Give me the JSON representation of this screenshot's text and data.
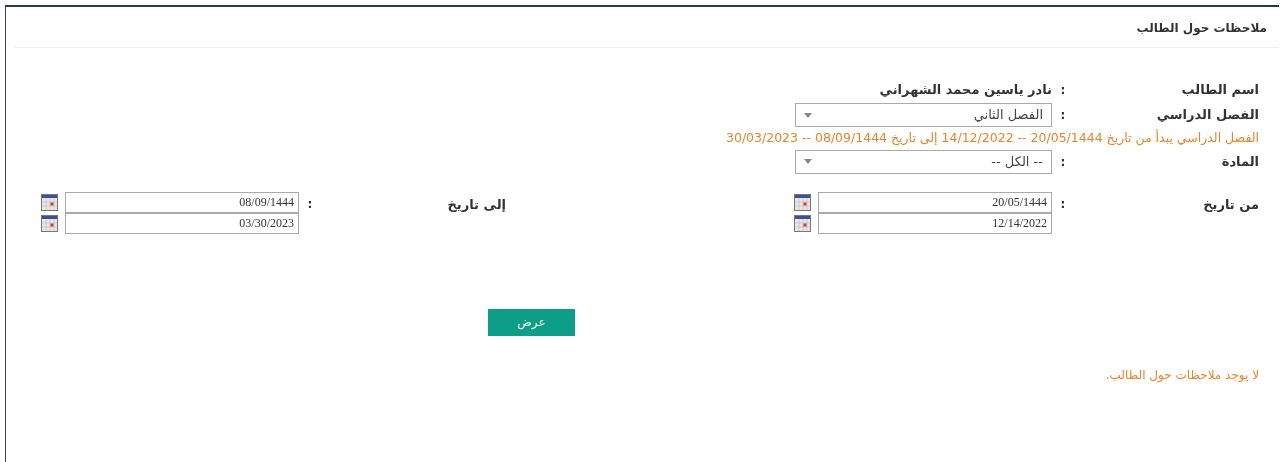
{
  "panel": {
    "title": "ملاحظات حول الطالب"
  },
  "fields": [
    {
      "kind": "text",
      "label": "اسم الطالب",
      "colon": ":",
      "value": "نادر ياسين محمد الشهراني"
    },
    {
      "kind": "select",
      "label": "الفصل الدراسي",
      "colon": ":",
      "value": "الفصل الثاني"
    },
    {
      "kind": "note",
      "text": "الفصل الدراسي يبدأ من تاريخ 20/05/1444 -- 14/12/2022 إلى تاريخ 08/09/1444 -- 30/03/2023"
    },
    {
      "kind": "select",
      "label": "المادة",
      "colon": ":",
      "value": "-- الكل --"
    }
  ],
  "date_ranges": [
    {
      "label": "من تاريخ",
      "colon": ":",
      "hijri": "20/05/1444",
      "gregorian": "12/14/2022"
    },
    {
      "label": "إلى تاريخ",
      "colon": ":",
      "hijri": "08/09/1444",
      "gregorian": "03/30/2023"
    }
  ],
  "button": "عرض",
  "message": "لا يوجد ملاحظات حول الطالب."
}
